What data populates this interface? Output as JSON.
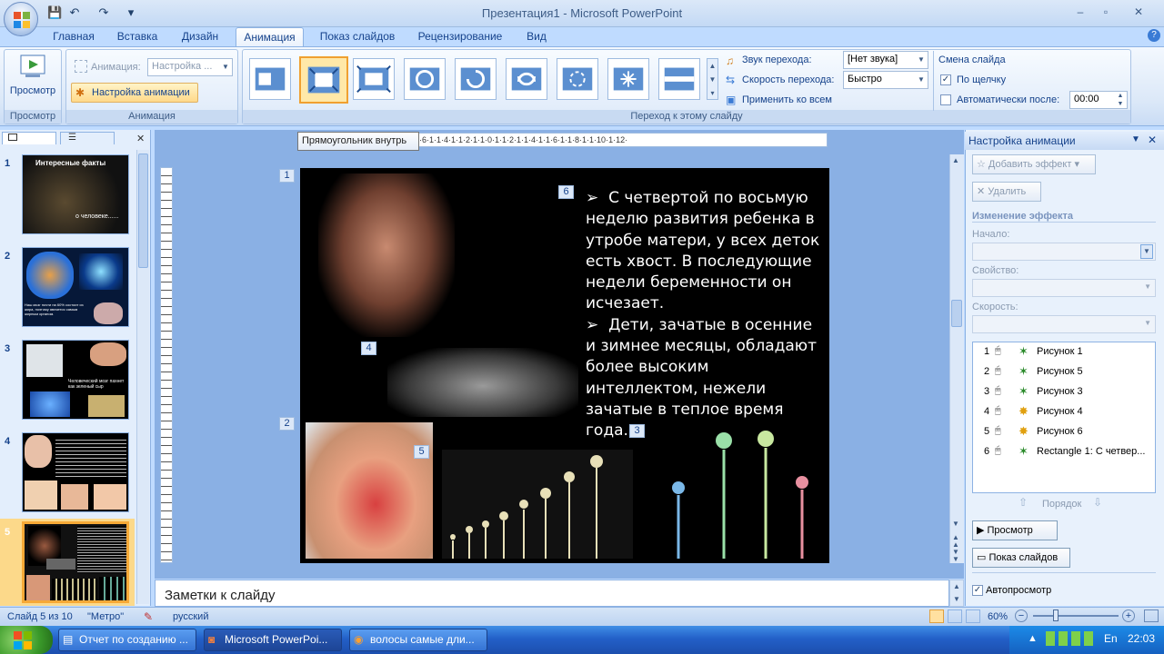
{
  "window": {
    "title": "Презентация1 - Microsoft PowerPoint",
    "minimize": "–",
    "maximize": "▫",
    "close": "✕"
  },
  "qat": {
    "save": "💾",
    "undo": "↶",
    "redo": "↷",
    "customize": "▾"
  },
  "tabs": [
    {
      "label": "Главная"
    },
    {
      "label": "Вставка"
    },
    {
      "label": "Дизайн"
    },
    {
      "label": "Анимация"
    },
    {
      "label": "Показ слайдов"
    },
    {
      "label": "Рецензирование"
    },
    {
      "label": "Вид"
    }
  ],
  "ribbon": {
    "preview": {
      "label": "Просмотр",
      "group": "Просмотр"
    },
    "animation": {
      "label": "Анимация:",
      "value": "Настройка ...",
      "custom_button": "Настройка анимации",
      "group": "Анимация"
    },
    "transition": {
      "sound_label": "Звук перехода:",
      "sound_value": "[Нет звука]",
      "speed_label": "Скорость перехода:",
      "speed_value": "Быстро",
      "apply_all": "Применить ко всем",
      "group": "Переход к этому слайду"
    },
    "advance": {
      "title": "Смена слайда",
      "on_click": "По щелчку",
      "auto_after": "Автоматически после:",
      "time": "00:00"
    }
  },
  "tooltip": "Прямоугольник внутрь",
  "ruler": {
    "h_ticks": "·6·1·1·4·1·1·2·1·1·0·1·1·2·1·1·4·1·1·6·1·1·8·1·1·10·1·12·"
  },
  "thumbnails": [
    {
      "num": "1",
      "title": "Интересные факты",
      "subtitle": "о человеке......"
    },
    {
      "num": "2",
      "text": "Наш мозг почти на 60% состоит из жира, поэтому является самым жирным органом."
    },
    {
      "num": "3",
      "text": "Человеческий мозг пахнет как зеленый сыр"
    },
    {
      "num": "4",
      "text": ""
    },
    {
      "num": "5",
      "text": ""
    }
  ],
  "slide": {
    "bullets": [
      "С четвертой по восьмую неделю развития ребенка в утробе матери, у всех деток есть хвост. В последующие недели беременности он исчезает.",
      "Дети, зачатые в осенние и зимнее месяцы, обладают более высоким интеллектом, нежели зачатые в теплое время года."
    ],
    "markers": [
      "1",
      "2",
      "3",
      "4",
      "5",
      "6"
    ]
  },
  "notes": "Заметки к слайду",
  "pane": {
    "title": "Настройка анимации",
    "add_effect": "Добавить эффект",
    "remove": "Удалить",
    "change_effect": "Изменение эффекта",
    "start": "Начало:",
    "property": "Свойство:",
    "speed": "Скорость:",
    "effects": [
      {
        "num": "1",
        "name": "Рисунок 1"
      },
      {
        "num": "2",
        "name": "Рисунок 5"
      },
      {
        "num": "3",
        "name": "Рисунок 3"
      },
      {
        "num": "4",
        "name": "Рисунок 4"
      },
      {
        "num": "5",
        "name": "Рисунок 6"
      },
      {
        "num": "6",
        "name": "Rectangle 1: С четвер..."
      }
    ],
    "order": "Порядок",
    "preview": "Просмотр",
    "slideshow": "Показ слайдов",
    "autopreview": "Автопросмотр"
  },
  "status": {
    "slide": "Слайд 5 из 10",
    "theme": "\"Метро\"",
    "language": "русский",
    "zoom": "60%"
  },
  "taskbar": {
    "items": [
      {
        "label": "Отчет по созданию ..."
      },
      {
        "label": "Microsoft PowerPoi..."
      },
      {
        "label": "волосы самые дли..."
      }
    ],
    "lang": "En",
    "time": "22:03"
  },
  "colors": {
    "accent": "#f6a937",
    "ribbon": "#bfdbff",
    "text": "#15428b"
  }
}
